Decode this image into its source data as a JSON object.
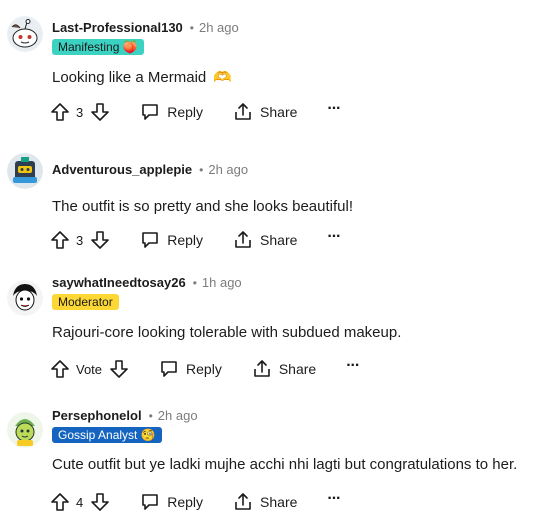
{
  "comments": [
    {
      "username": "Last-Professional130",
      "time": "2h ago",
      "flair": {
        "text": "Manifesting",
        "emoji": "🍑",
        "bg": "#3cd2c1",
        "fg": "#1a1a1b"
      },
      "body": "Looking like a Mermaid",
      "body_emoji": "🫶",
      "vote_count": "3",
      "reply_label": "Reply",
      "share_label": "Share"
    },
    {
      "username": "Adventurous_applepie",
      "time": "2h ago",
      "body": "The outfit is so pretty and she looks beautiful!",
      "vote_count": "3",
      "reply_label": "Reply",
      "share_label": "Share"
    },
    {
      "username": "saywhatIneedtosay26",
      "time": "1h ago",
      "flair": {
        "text": "Moderator",
        "bg": "#fdd835",
        "fg": "#1a1a1b"
      },
      "body": "Rajouri-core looking tolerable with subdued makeup.",
      "vote_count": "Vote",
      "reply_label": "Reply",
      "share_label": "Share"
    },
    {
      "username": "Persephonelol",
      "time": "2h ago",
      "flair": {
        "text": "Gossip Analyst",
        "emoji": "🧐",
        "bg": "#1565c0",
        "fg": "#ffffff"
      },
      "body": "Cute outfit but ye ladki mujhe acchi nhi lagti but congratulations to her.",
      "vote_count": "4",
      "reply_label": "Reply",
      "share_label": "Share"
    }
  ],
  "colors": {
    "text": "#1c1c1c",
    "meta": "#7c7c7c"
  },
  "icons": [
    "upvote-icon",
    "downvote-icon",
    "reply-icon",
    "share-icon",
    "more-options-icon"
  ]
}
